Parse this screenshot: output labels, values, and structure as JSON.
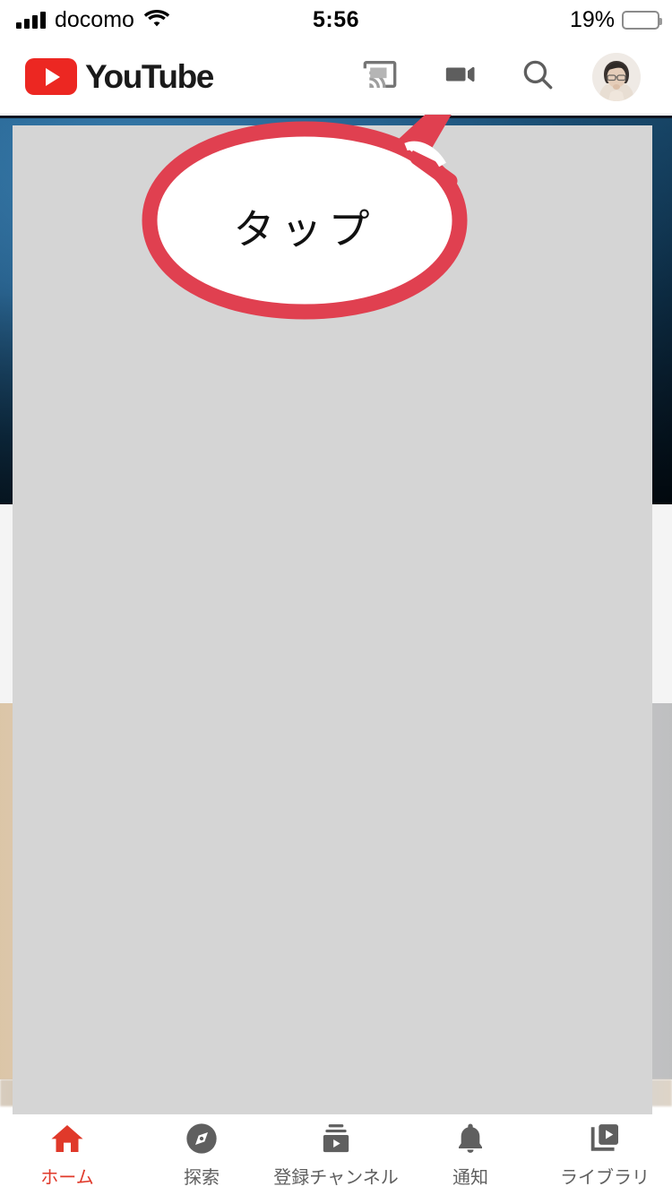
{
  "status_bar": {
    "carrier": "docomo",
    "signal_icon": "signal-bars-icon",
    "wifi_icon": "wifi-icon",
    "time": "5:56",
    "battery_percent": "19%",
    "battery_level": 19,
    "battery_color": "#ee3b2f"
  },
  "header": {
    "logo_text": "YouTube",
    "logo_color": "#ec2722",
    "actions": [
      {
        "name": "cast-icon",
        "label": "Cast"
      },
      {
        "name": "video-camera-icon",
        "label": "Create video"
      },
      {
        "name": "search-icon",
        "label": "Search"
      },
      {
        "name": "avatar",
        "label": "Account"
      }
    ]
  },
  "tooltip": {
    "text": "タップ",
    "outline_color": "#e04050",
    "fill_color": "#ffffff",
    "points_to": "video-camera-icon"
  },
  "overlay": {
    "color": "#d5d5d5",
    "note": "gray masking rectangle covering the video feed"
  },
  "feed": {
    "items": [
      {
        "name": "video-thumbnail-1",
        "tone": "blue"
      },
      {
        "name": "video-thumbnail-2",
        "tone": "tan"
      }
    ]
  },
  "bottom_nav": {
    "active_index": 0,
    "active_color": "#e0392a",
    "inactive_color": "#5f5f5f",
    "items": [
      {
        "label": "ホーム",
        "icon": "home-icon"
      },
      {
        "label": "探索",
        "icon": "compass-icon"
      },
      {
        "label": "登録チャンネル",
        "icon": "subscriptions-icon"
      },
      {
        "label": "通知",
        "icon": "bell-icon"
      },
      {
        "label": "ライブラリ",
        "icon": "library-icon"
      }
    ]
  }
}
